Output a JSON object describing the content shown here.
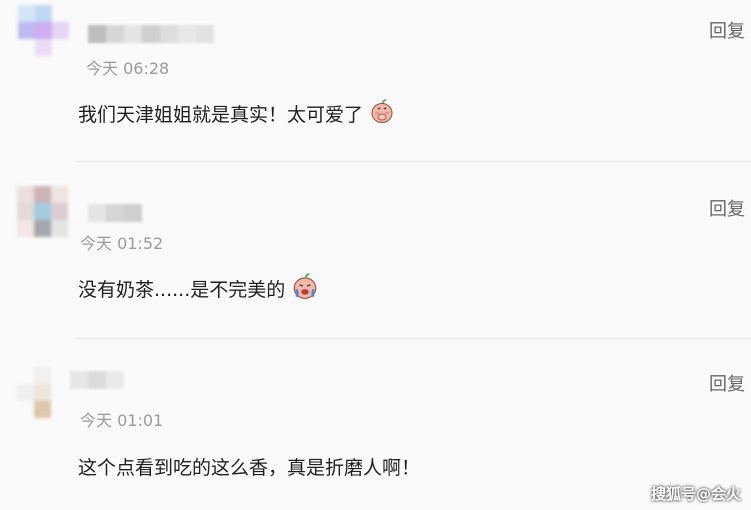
{
  "comments": [
    {
      "time": "今天 06:28",
      "text": "我们天津姐姐就是真实！太可爱了",
      "reply_label": "回复",
      "emoji": "peach-covering-mouth"
    },
    {
      "time": "今天 01:52",
      "text": "没有奶茶......是不完美的",
      "reply_label": "回复",
      "emoji": "peach-crying"
    },
    {
      "time": "今天 01:01",
      "text": "这个点看到吃的这么香，真是折磨人啊！",
      "reply_label": "回复",
      "emoji": ""
    }
  ],
  "watermark": "搜狐号@会火",
  "colors": {
    "background": "#fafafa",
    "time": "#9a9a9a",
    "reply": "#666666",
    "divider": "#e6e6e6"
  }
}
